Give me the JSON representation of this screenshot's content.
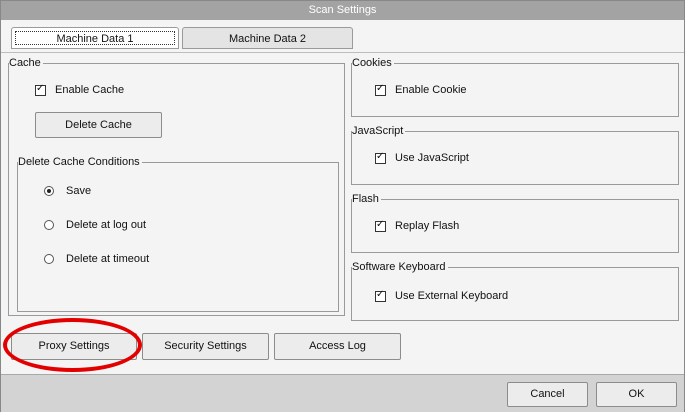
{
  "window": {
    "title": "Scan Settings"
  },
  "tabs": [
    {
      "label": "Machine Data 1"
    },
    {
      "label": "Machine Data 2"
    }
  ],
  "cache": {
    "title": "Cache",
    "enable_cache": {
      "label": "Enable Cache",
      "checked": true
    },
    "delete_cache_label": "Delete Cache",
    "conditions": {
      "title": "Delete Cache Conditions",
      "options": [
        {
          "label": "Save",
          "selected": true
        },
        {
          "label": "Delete at log out",
          "selected": false
        },
        {
          "label": "Delete at timeout",
          "selected": false
        }
      ]
    }
  },
  "cookies": {
    "title": "Cookies",
    "label": "Enable Cookie",
    "checked": true
  },
  "javascript": {
    "title": "JavaScript",
    "label": "Use JavaScript",
    "checked": true
  },
  "flash": {
    "title": "Flash",
    "label": "Replay Flash",
    "checked": true
  },
  "keyboard": {
    "title": "Software Keyboard",
    "label": "Use External Keyboard",
    "checked": true
  },
  "bottom_buttons": {
    "proxy": "Proxy Settings",
    "security": "Security Settings",
    "access_log": "Access Log"
  },
  "footer": {
    "cancel": "Cancel",
    "ok": "OK"
  },
  "colors": {
    "highlight": "#e20000",
    "titlebar": "#a3a3a3"
  }
}
